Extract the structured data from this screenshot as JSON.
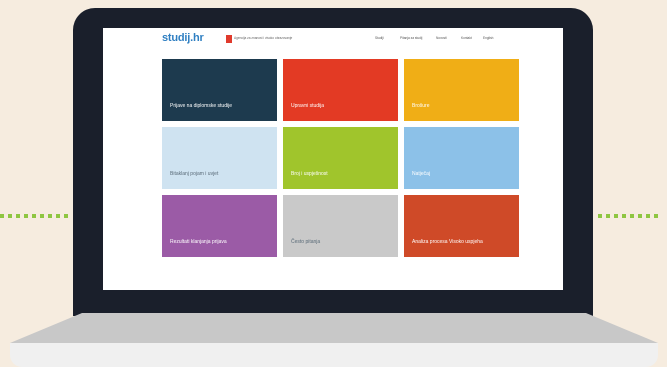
{
  "site": {
    "logo": "studij.hr",
    "brand_text": "Agencija za znanost i visoko obrazovanje",
    "nav": [
      "Studiji",
      "Pitanja za studij",
      "Novosti",
      "Kontakt",
      "English"
    ]
  },
  "tiles": [
    {
      "label": "Prijave na diplomske studije",
      "color": "#1d3a4e"
    },
    {
      "label": "Upravni studija",
      "color": "#e33a24"
    },
    {
      "label": "Brošure",
      "color": "#f0ae16"
    },
    {
      "label": "Bitaklanj pojam i uvjet",
      "color": "#cfe3f1"
    },
    {
      "label": "Broj i uspješnost",
      "color": "#a0c52c"
    },
    {
      "label": "Natječaj",
      "color": "#8cc1e8"
    },
    {
      "label": "Rezultati klanjanja prijava",
      "color": "#9b5ba6"
    },
    {
      "label": "Često pitanja",
      "color": "#c9c9c9"
    },
    {
      "label": "Analiza procesa Visoko uspjeha",
      "color": "#cf4a28"
    }
  ],
  "decor": {
    "dots_color": "#8fc641"
  }
}
